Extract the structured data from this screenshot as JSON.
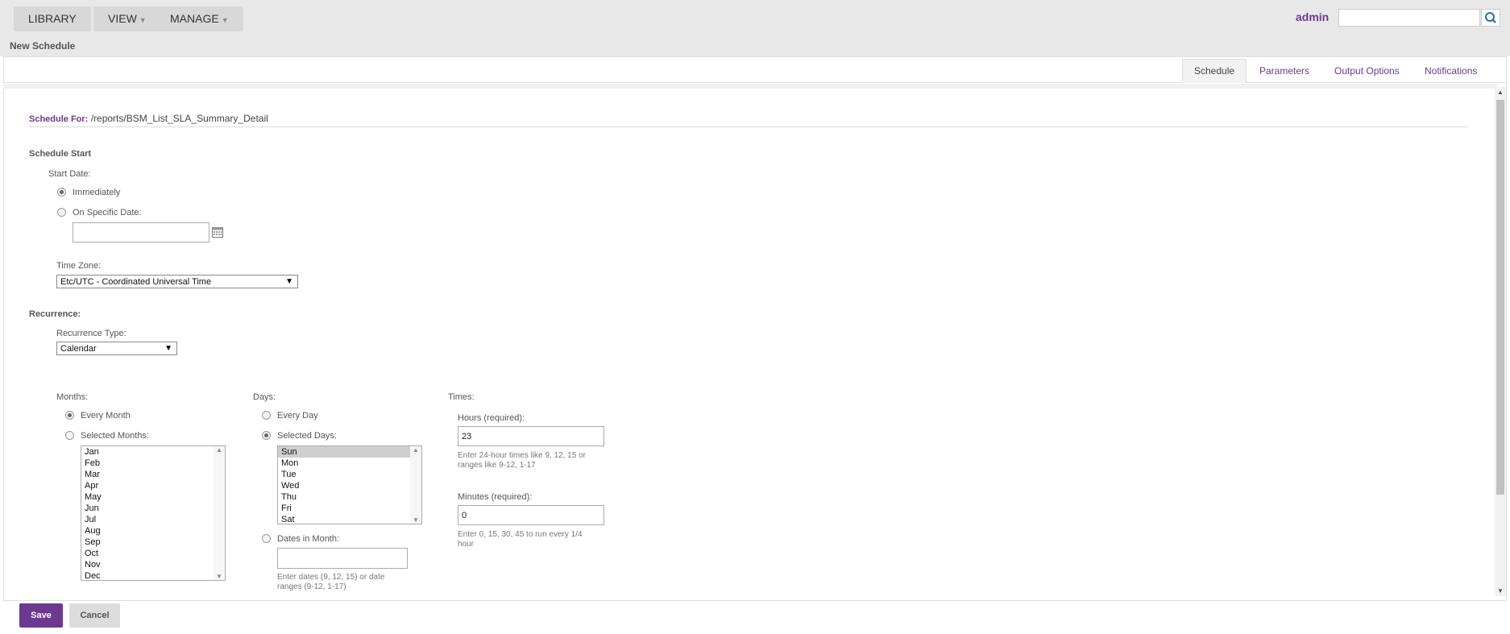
{
  "nav": {
    "library": "LIBRARY",
    "view": "VIEW",
    "manage": "MANAGE",
    "user": "admin",
    "search_placeholder": ""
  },
  "page_title": "New Schedule",
  "tabs": [
    "Schedule",
    "Parameters",
    "Output Options",
    "Notifications"
  ],
  "schedule_for": {
    "label": "Schedule For:",
    "value": "/reports/BSM_List_SLA_Summary_Detail"
  },
  "schedule_start": {
    "heading": "Schedule Start",
    "start_date_label": "Start Date:",
    "immediately": "Immediately",
    "specific_date": "On Specific Date:",
    "date_value": "",
    "time_zone_label": "Time Zone:",
    "time_zone_value": "Etc/UTC - Coordinated Universal Time"
  },
  "recurrence": {
    "heading": "Recurrence:",
    "type_label": "Recurrence Type:",
    "type_value": "Calendar"
  },
  "months": {
    "label": "Months:",
    "every_month": "Every Month",
    "selected_months": "Selected Months:",
    "options": [
      "Jan",
      "Feb",
      "Mar",
      "Apr",
      "May",
      "Jun",
      "Jul",
      "Aug",
      "Sep",
      "Oct",
      "Nov",
      "Dec"
    ]
  },
  "days": {
    "label": "Days:",
    "every_day": "Every Day",
    "selected_days": "Selected Days:",
    "options": [
      "Sun",
      "Mon",
      "Tue",
      "Wed",
      "Thu",
      "Fri",
      "Sat"
    ],
    "selected": "Sun",
    "dates_in_month": "Dates in Month:",
    "dates_value": "",
    "dates_hint_1": "Enter dates (9, 12, 15) or date",
    "dates_hint_2": "ranges (9-12, 1-17)"
  },
  "times": {
    "label": "Times:",
    "hours_label": "Hours (required):",
    "hours_value": "23",
    "hours_hint_1": "Enter 24-hour times like 9, 12, 15 or",
    "hours_hint_2": "ranges like 9-12, 1-17",
    "minutes_label": "Minutes (required):",
    "minutes_value": "0",
    "minutes_hint_1": "Enter 0, 15, 30, 45 to run every 1/4",
    "minutes_hint_2": "hour"
  },
  "footer": {
    "save": "Save",
    "cancel": "Cancel"
  },
  "colors": {
    "accent": "#6b3a8f",
    "topbar": "#e8e8e8"
  }
}
